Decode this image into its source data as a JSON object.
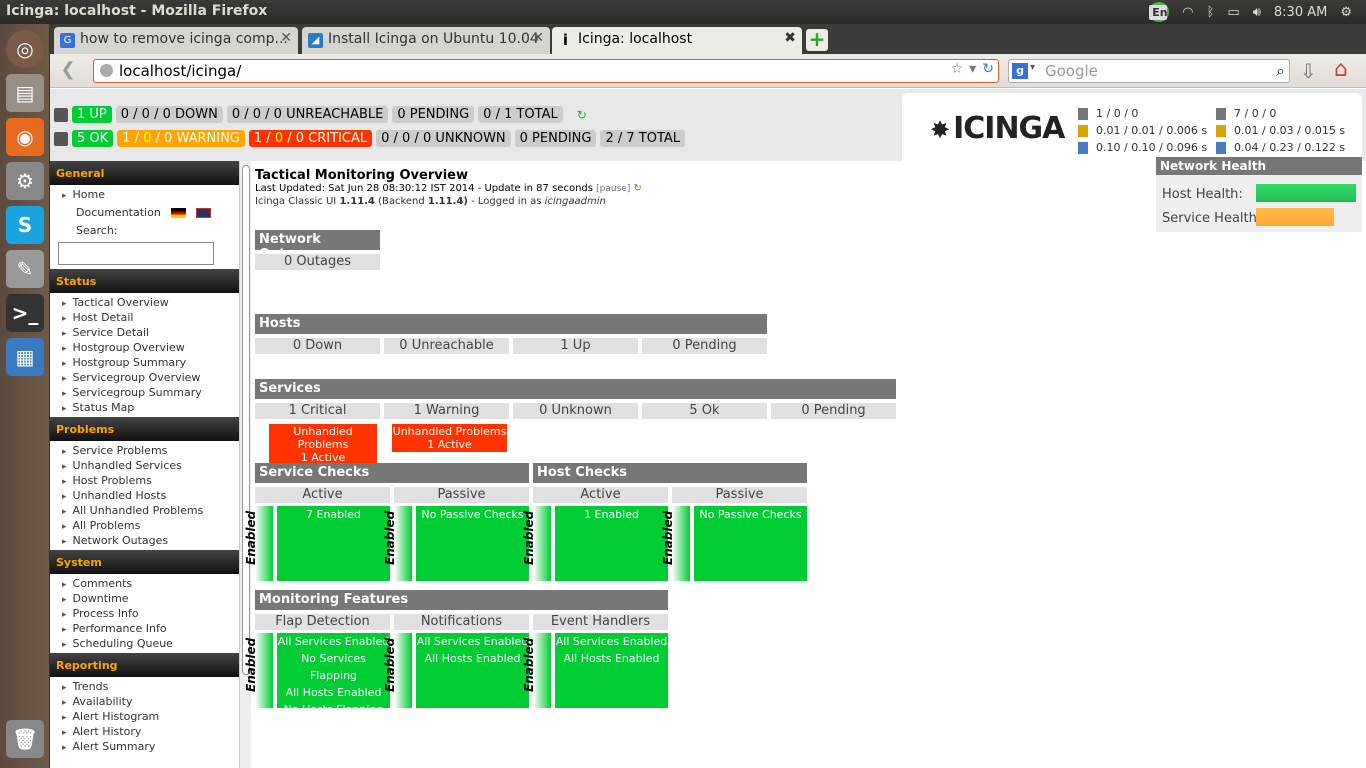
{
  "window": {
    "title": "Icinga: localhost - Mozilla Firefox",
    "time": "8:30 AM",
    "lang": "En"
  },
  "tabs": [
    {
      "label": "how to remove icinga comp...",
      "icon": "G",
      "color": "#3b6fd8"
    },
    {
      "label": "Install Icinga on Ubuntu 10.04",
      "icon": "◢",
      "color": "#2a7ac7"
    },
    {
      "label": "Icinga: localhost",
      "icon": "i",
      "color": "#fff"
    }
  ],
  "nav": {
    "url": "localhost/icinga/",
    "search_placeholder": "Google"
  },
  "status": {
    "hosts": [
      "1 UP",
      "0 / 0 / 0 DOWN",
      "0 / 0 / 0 UNREACHABLE",
      "0 PENDING",
      "0 / 1 TOTAL"
    ],
    "services": {
      "ok": "5 OK",
      "warning_a": "1",
      "warning_b": "0",
      "warning_c": "0 WARNING",
      "critical_a": "1",
      "critical_b": "0",
      "critical_c": "0 CRITICAL",
      "unknown": "0 / 0 / 0 UNKNOWN",
      "pending": "0 PENDING",
      "total": "2 / 7 TOTAL"
    }
  },
  "logo": "ICINGA",
  "stats_left": [
    "1 / 0 / 0",
    "0.01 / 0.01 / 0.006 s",
    "0.10 / 0.10 / 0.096 s"
  ],
  "stats_right": [
    "7 / 0 / 0",
    "0.01 / 0.03 / 0.015 s",
    "0.04 / 0.23 / 0.122 s"
  ],
  "sidebar": {
    "general": {
      "title": "General",
      "home": "Home",
      "documentation": "Documentation",
      "search_label": "Search:"
    },
    "status": {
      "title": "Status",
      "items": [
        "Tactical Overview",
        "Host Detail",
        "Service Detail",
        "Hostgroup Overview",
        "Hostgroup Summary",
        "Servicegroup Overview",
        "Servicegroup Summary",
        "Status Map"
      ]
    },
    "problems": {
      "title": "Problems",
      "items": [
        "Service Problems",
        "Unhandled Services",
        "Host Problems",
        "Unhandled Hosts",
        "All Unhandled Problems",
        "All Problems",
        "Network Outages"
      ]
    },
    "system": {
      "title": "System",
      "items": [
        "Comments",
        "Downtime",
        "Process Info",
        "Performance Info",
        "Scheduling Queue"
      ]
    },
    "reporting": {
      "title": "Reporting",
      "items": [
        "Trends",
        "Availability",
        "Alert Histogram",
        "Alert History",
        "Alert Summary"
      ]
    }
  },
  "main": {
    "title": "Tactical Monitoring Overview",
    "updated": "Last Updated: Sat Jun 28 08:30:12 IST 2014 - Update in 87 seconds",
    "pause": "[pause]",
    "version_prefix": "Icinga Classic UI",
    "version_ui": "1.11.4",
    "backend_label": "(Backend",
    "version_backend": "1.11.4)",
    "logged": "- Logged in as",
    "user": "icingaadmin",
    "outages": {
      "title": "Network Outages",
      "value": "0 Outages"
    },
    "hosts": {
      "title": "Hosts",
      "cells": [
        "0 Down",
        "0 Unreachable",
        "1 Up",
        "0 Pending"
      ]
    },
    "services": {
      "title": "Services",
      "cells": [
        "1 Critical",
        "1 Warning",
        "0 Unknown",
        "5 Ok",
        "0 Pending"
      ],
      "unhandled": [
        {
          "l1": "Unhandled Problems",
          "l2": "1 Active"
        },
        {
          "l1": "Unhandled Problems",
          "l2": "1 Active"
        }
      ]
    },
    "service_checks": {
      "title": "Service Checks",
      "active": "Active",
      "passive": "Passive",
      "active_val": "7 Enabled",
      "passive_val": "No Passive Checks"
    },
    "host_checks": {
      "title": "Host Checks",
      "active": "Active",
      "passive": "Passive",
      "active_val": "1 Enabled",
      "passive_val": "No Passive Checks"
    },
    "enabled_label": "Enabled",
    "features": {
      "title": "Monitoring Features",
      "flap": "Flap Detection",
      "notif": "Notifications",
      "events": "Event Handlers",
      "flap_vals": [
        "All Services Enabled",
        "No Services Flapping",
        "All Hosts Enabled",
        "No Hosts Flapping"
      ],
      "notif_vals": [
        "All Services Enabled",
        "All Hosts Enabled"
      ],
      "event_vals": [
        "All Services Enabled",
        "All Hosts Enabled"
      ]
    }
  },
  "health": {
    "title": "Network Health",
    "host_label": "Host Health:",
    "service_label": "Service Health:",
    "host_pct": 100,
    "service_pct": 78,
    "host_color": "#33dd66",
    "service_color": "#ffbb44"
  }
}
